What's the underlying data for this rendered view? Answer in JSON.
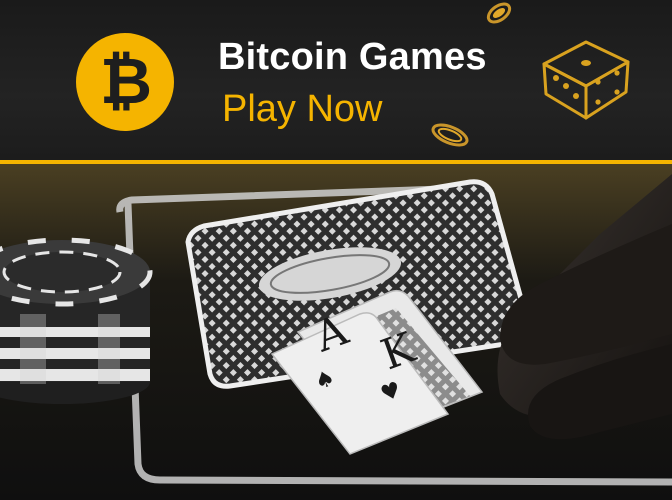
{
  "header": {
    "title": "Bitcoin Games",
    "cta_label": "Play Now",
    "logo_symbol": "₿",
    "icons": [
      "bitcoin-icon",
      "dice-icon",
      "coin-icon"
    ]
  },
  "photo": {
    "card_ranks": [
      "A",
      "K"
    ],
    "subject": "poker-table-with-chips-and-cards"
  },
  "colors": {
    "accent": "#f5b400",
    "header_bg": "#1e1e1e",
    "title_text": "#ffffff"
  }
}
